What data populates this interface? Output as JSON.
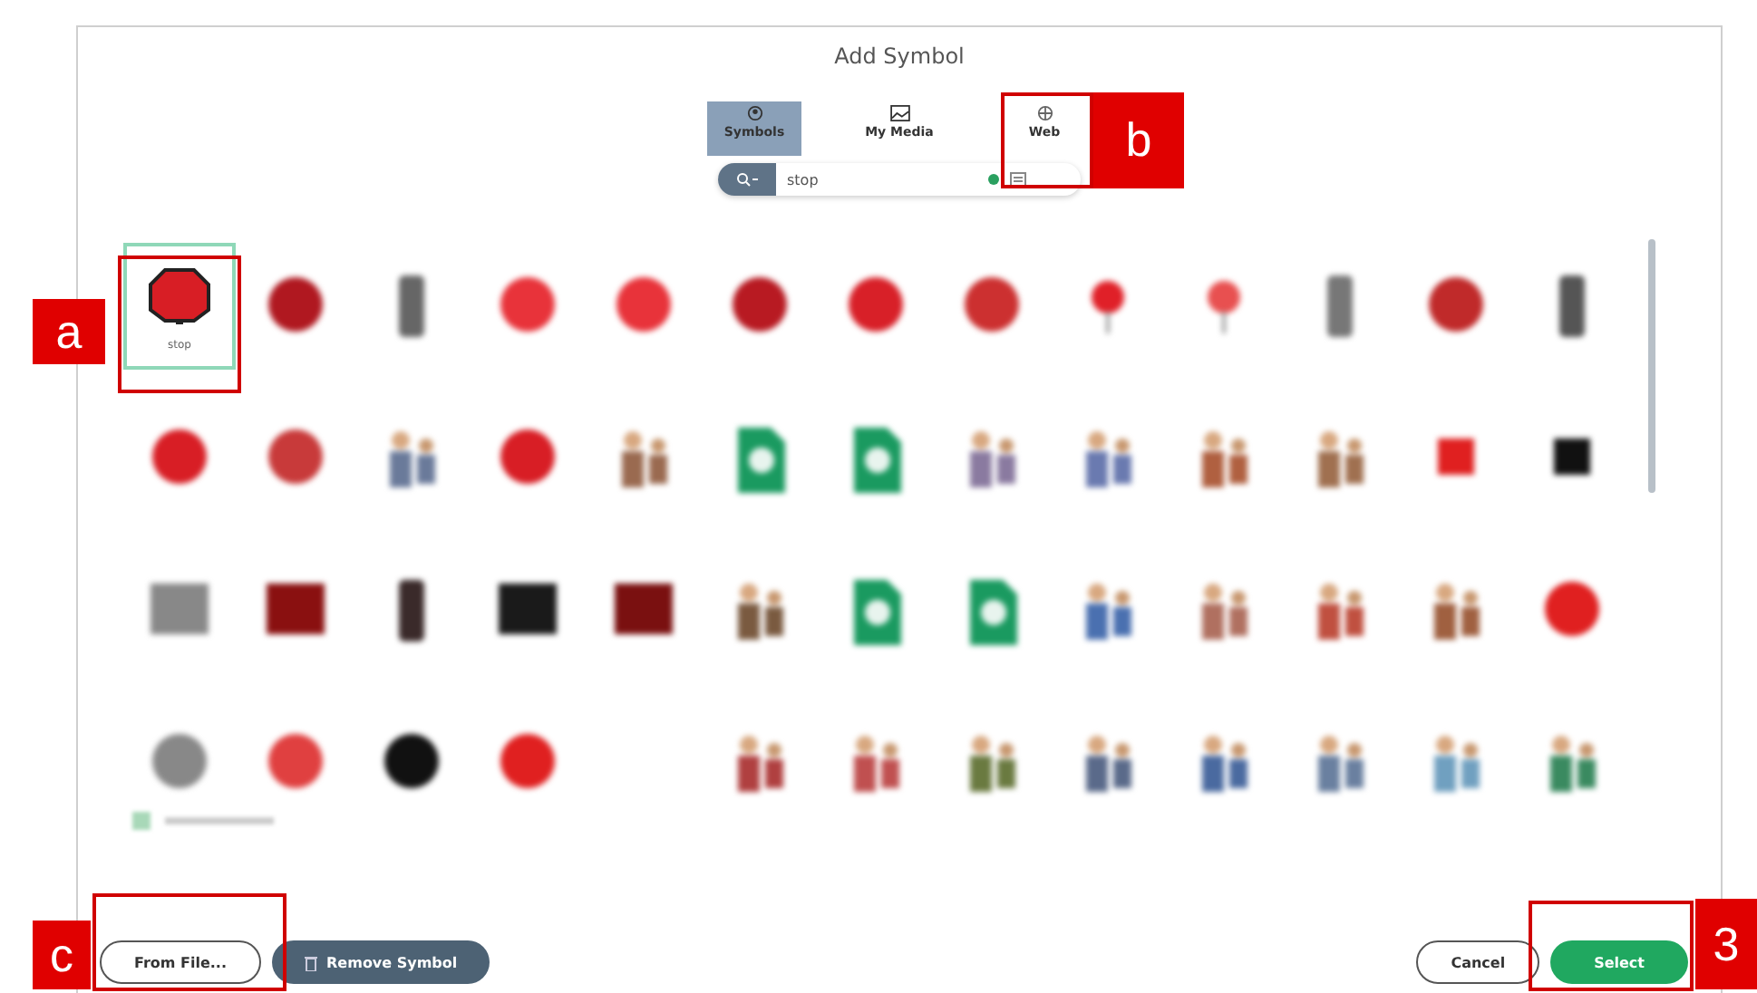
{
  "dialog": {
    "title": "Add Symbol"
  },
  "tabs": [
    {
      "label": "Symbols",
      "selected": true
    },
    {
      "label": "My Media",
      "selected": false
    },
    {
      "label": "Web",
      "selected": false
    }
  ],
  "search": {
    "value": "stop"
  },
  "symbols": [
    {
      "kind": "octagon",
      "color": "#d81e25",
      "label": "stop",
      "selected": true
    },
    {
      "kind": "circle",
      "color": "#b01820",
      "selected": false
    },
    {
      "kind": "light",
      "color": "#666666",
      "selected": false
    },
    {
      "kind": "circle",
      "color": "#e8333a",
      "selected": false
    },
    {
      "kind": "circle",
      "color": "#e8333a",
      "selected": false
    },
    {
      "kind": "circle",
      "color": "#b81a22",
      "selected": false
    },
    {
      "kind": "circle",
      "color": "#d82028",
      "selected": false
    },
    {
      "kind": "circle",
      "color": "#cc3030",
      "selected": false
    },
    {
      "kind": "pin",
      "color": "#e02028",
      "selected": false
    },
    {
      "kind": "pin",
      "color": "#e85050",
      "selected": false
    },
    {
      "kind": "light",
      "color": "#777777",
      "selected": false
    },
    {
      "kind": "circle",
      "color": "#c02a2a",
      "selected": false
    },
    {
      "kind": "light",
      "color": "#555555",
      "selected": false
    },
    {
      "kind": "circle",
      "color": "#d81e25",
      "selected": false
    },
    {
      "kind": "circle",
      "color": "#c83a3a",
      "selected": false
    },
    {
      "kind": "figure",
      "color": "#6a7a9a",
      "selected": false
    },
    {
      "kind": "circle",
      "color": "#d81e25",
      "selected": false
    },
    {
      "kind": "figure",
      "color": "#9a6a50",
      "selected": false
    },
    {
      "kind": "doc",
      "color": "#1a9a60",
      "selected": false
    },
    {
      "kind": "doc",
      "color": "#1a9a60",
      "selected": false
    },
    {
      "kind": "figure",
      "color": "#8a7aa0",
      "selected": false
    },
    {
      "kind": "figure",
      "color": "#6a7ab0",
      "selected": false
    },
    {
      "kind": "figure",
      "color": "#b06040",
      "selected": false
    },
    {
      "kind": "figure",
      "color": "#a07050",
      "selected": false
    },
    {
      "kind": "square",
      "color": "#e02020",
      "selected": false
    },
    {
      "kind": "square",
      "color": "#111111",
      "selected": false
    },
    {
      "kind": "rect",
      "color": "#888888",
      "selected": false
    },
    {
      "kind": "rect",
      "color": "#8a1010",
      "selected": false
    },
    {
      "kind": "light",
      "color": "#3a2a2a",
      "selected": false
    },
    {
      "kind": "rect",
      "color": "#1a1a1a",
      "selected": false
    },
    {
      "kind": "rect",
      "color": "#7a1010",
      "selected": false
    },
    {
      "kind": "figure",
      "color": "#7a5a40",
      "selected": false
    },
    {
      "kind": "doc",
      "color": "#1a9a60",
      "selected": false
    },
    {
      "kind": "doc",
      "color": "#1a9a60",
      "selected": false
    },
    {
      "kind": "figure",
      "color": "#4a70b0",
      "selected": false
    },
    {
      "kind": "figure",
      "color": "#b07060",
      "selected": false
    },
    {
      "kind": "figure",
      "color": "#c05040",
      "selected": false
    },
    {
      "kind": "figure",
      "color": "#a06040",
      "selected": false
    },
    {
      "kind": "circle",
      "color": "#e02020",
      "selected": false
    },
    {
      "kind": "circle",
      "color": "#888888",
      "selected": false
    },
    {
      "kind": "circle",
      "color": "#e04040",
      "selected": false
    },
    {
      "kind": "circle",
      "color": "#111111",
      "selected": false
    },
    {
      "kind": "circle",
      "color": "#e02020",
      "selected": false
    },
    {
      "kind": "empty"
    },
    {
      "kind": "figure",
      "color": "#b04040",
      "selected": false
    },
    {
      "kind": "figure",
      "color": "#c05050",
      "selected": false
    },
    {
      "kind": "figure",
      "color": "#6a7a40",
      "selected": false
    },
    {
      "kind": "figure",
      "color": "#5a6a8a",
      "selected": false
    },
    {
      "kind": "figure",
      "color": "#4a6aa0",
      "selected": false
    },
    {
      "kind": "figure",
      "color": "#6a80a0",
      "selected": false
    },
    {
      "kind": "figure",
      "color": "#70a0c0",
      "selected": false
    },
    {
      "kind": "figure",
      "color": "#3a8a60",
      "selected": false
    }
  ],
  "buttons": [
    {
      "label": "From File...",
      "kind": "outline"
    },
    {
      "label": "Remove Symbol",
      "kind": "dark"
    },
    {
      "label": "Cancel",
      "kind": "outline"
    },
    {
      "label": "Select",
      "kind": "primary"
    }
  ],
  "annotations": [
    {
      "label": "a"
    },
    {
      "label": "b"
    },
    {
      "label": "c"
    },
    {
      "label": "3"
    }
  ]
}
